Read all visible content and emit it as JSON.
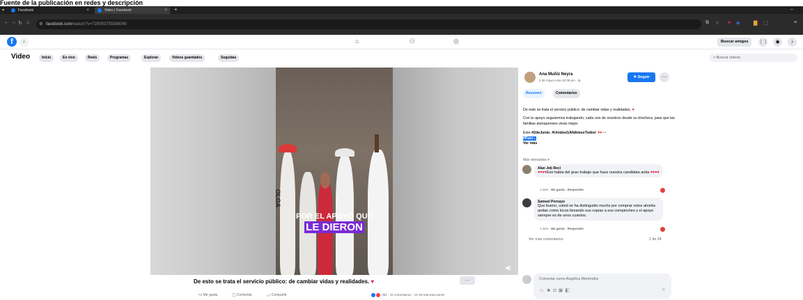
{
  "caption": "Fuente de la publicación en redes y descripción",
  "browser": {
    "tabs": [
      {
        "label": "Facebook"
      },
      {
        "label": "Video | Facebook"
      }
    ],
    "new_tab": "+",
    "url_domain": "facebook.com",
    "url_path": "/watch/?v=728093759398060"
  },
  "fb_header": {
    "logo": "f",
    "find_friends": "Buscar amigos"
  },
  "video_nav": {
    "title": "Video",
    "tabs": [
      "Inicio",
      "En vivo",
      "Reels",
      "Programas",
      "Explorar",
      "Videos guardados",
      "Seguidas"
    ],
    "search_placeholder": "Buscar videos"
  },
  "video": {
    "overlay_line1": "POR EL APOYO QUE",
    "overlay_line2": "LE DIERON",
    "shirt_text": "OLGA"
  },
  "post": {
    "title": "De esto se trata el servicio público: de cambiar vidas y realidades.",
    "actions": {
      "like": "Me gusta",
      "comment": "Comentar",
      "share": "Compartir"
    },
    "stats": "381 · 42 comentarios · 10 mil reproducciones"
  },
  "panel": {
    "author": "Ana Muñiz Neyra",
    "date": "4 de mayo a las 10:09 pm · ",
    "follow": "Seguir",
    "tabs": {
      "summary": "Resumen",
      "comments": "Comentarios"
    },
    "desc1": "De esto se trata el servicio público: de cambiar vidas y realidades.",
    "desc2": "Con tu apoyo seguiremos trabajando, cada uno de nosotros desde su trinchera, para que las familias atenquenses vivan mejor.",
    "desc3_prefix": "Este ",
    "desc3_tag1": "#2deJunio",
    "desc3_sep": ", ",
    "desc3_tag2": "#UnidosGANAmosTodos",
    "desc3_suffix": "!",
    "desc4": "#Fuer...",
    "see_more": "Ver más",
    "relevance": "Más relevantes ▾",
    "comments": [
      {
        "name": "Alan Job Reci",
        "text": "Eso habla del gran trabajo que hace nuestra candidata anita",
        "time": "1 sem",
        "like": "Me gusta",
        "reply": "Responder"
      },
      {
        "name": "Samuel Porcayo",
        "text": "Que bueno, usted se ha distinguido mucho por comprar votos ahorita andan como locos llevando sus copias a sus compinches y el apoyo siempre es de unos cuantos.",
        "time": "1 sem",
        "like": "Me gusta",
        "reply": "Responder"
      }
    ],
    "see_more_comments": "Ver más comentarios",
    "page_count": "2 de 34",
    "comment_placeholder": "Comentar como Angélica Menéndez"
  },
  "colors": {
    "fb_blue": "#1877f2",
    "highlight_purple": "#7a2bd6",
    "heart_red": "#e41e3f"
  },
  "icons": [
    "home-icon",
    "friends-icon",
    "groups-icon",
    "menu-grid-icon",
    "messenger-icon",
    "bell-icon",
    "volume-icon"
  ]
}
